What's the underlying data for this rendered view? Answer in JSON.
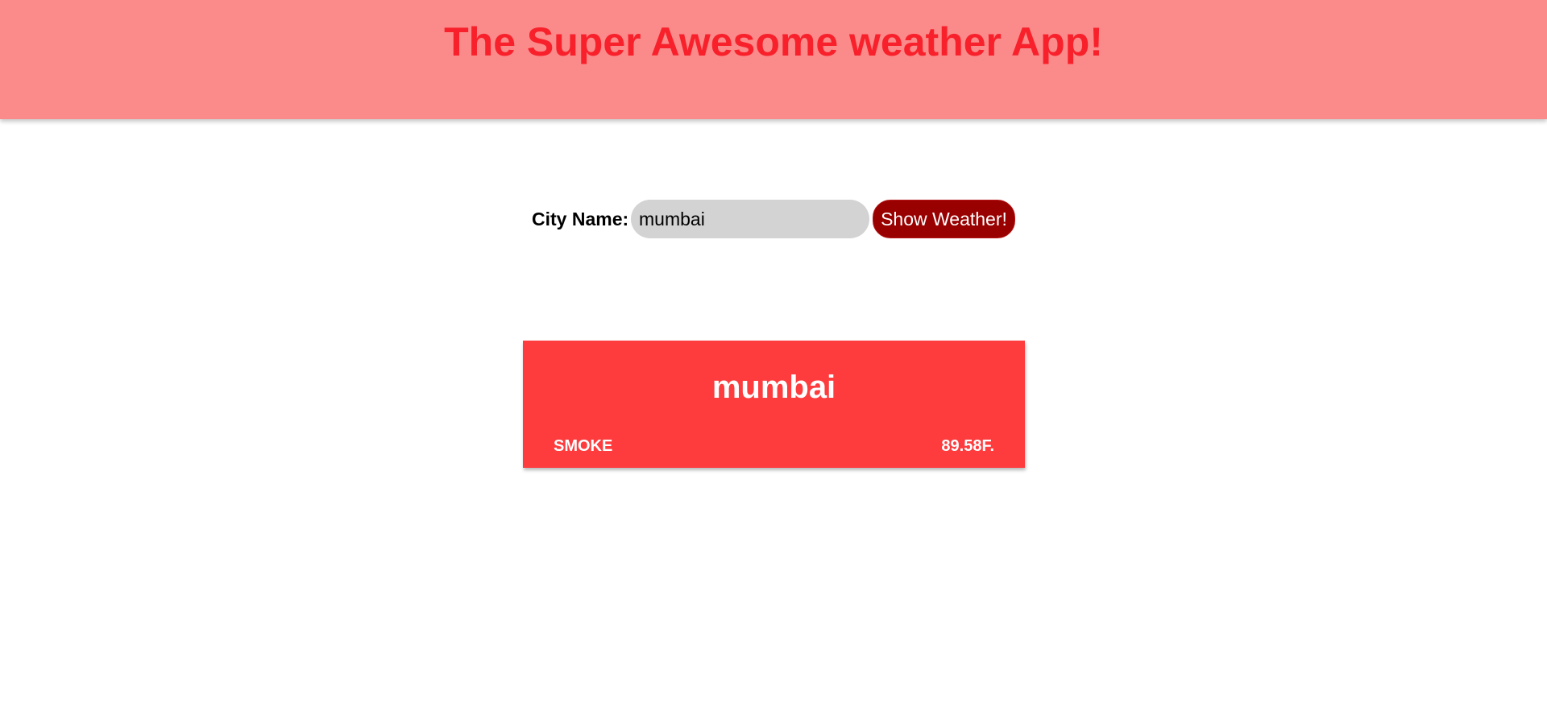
{
  "header": {
    "title": "The Super Awesome weather App!"
  },
  "search": {
    "label": "City Name:",
    "input_value": "mumbai",
    "button_label": "Show Weather!"
  },
  "weather_card": {
    "city": "mumbai",
    "condition": "SMOKE",
    "temperature": "89.58F."
  },
  "colors": {
    "header_background": "#fb8b8b",
    "title_text": "#f8212b",
    "input_background": "#d3d3d3",
    "button_background": "#990000",
    "card_background": "#fe3b3d"
  }
}
